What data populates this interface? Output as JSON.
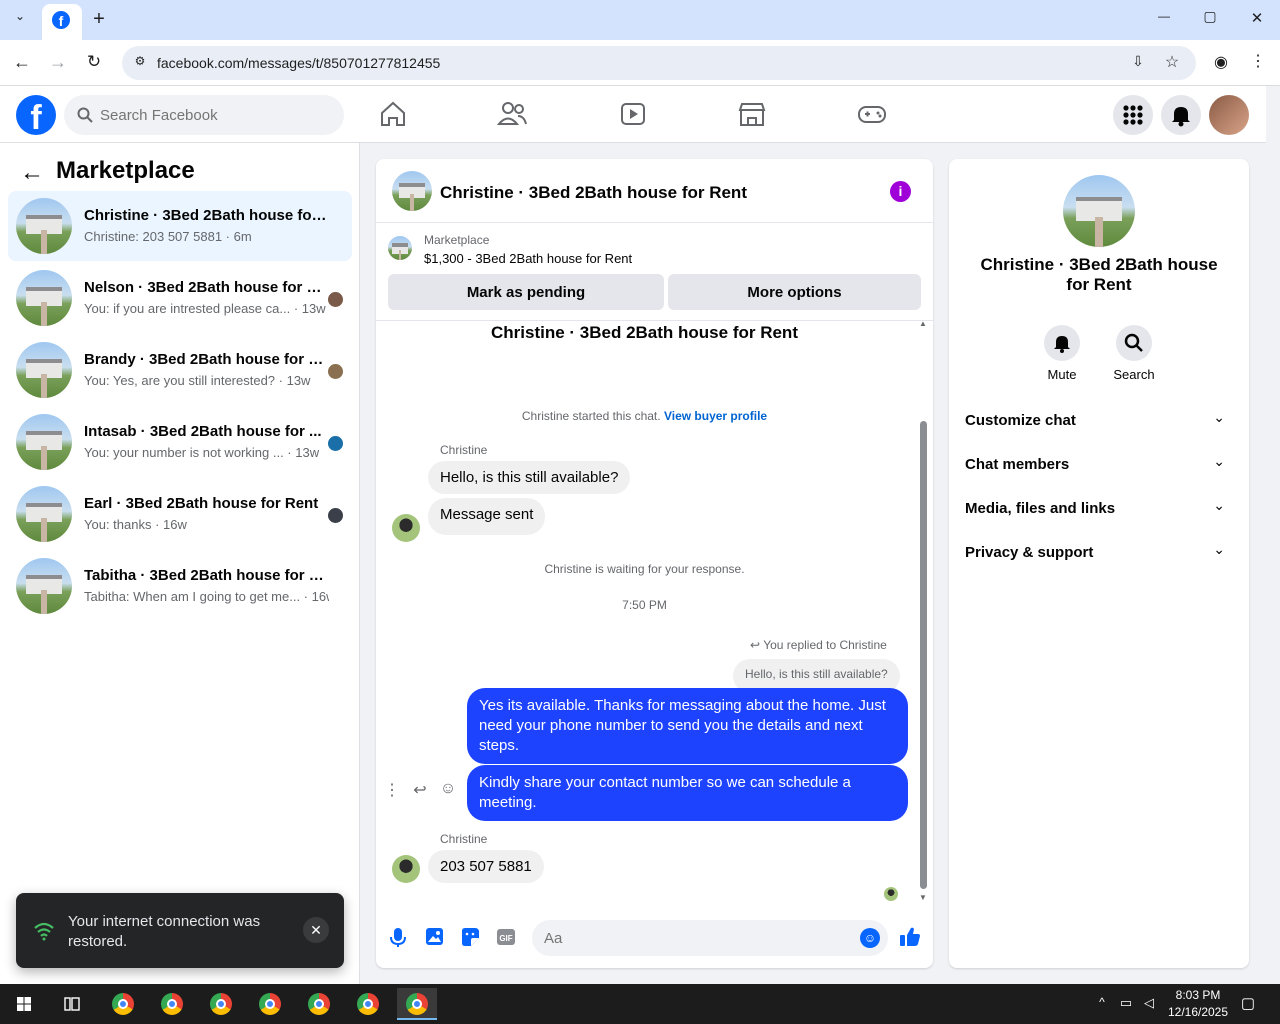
{
  "browser": {
    "url": "facebook.com/messages/t/850701277812455",
    "new_tab": "+",
    "window_controls": {
      "minimize": "—",
      "maximize": "▢",
      "close": "✕"
    }
  },
  "header": {
    "search_placeholder": "Search Facebook"
  },
  "left": {
    "title": "Marketplace",
    "conversations": [
      {
        "name": "Christine · 3Bed 2Bath house for R...",
        "snippet": "Christine: 203 507 5881 · 6m",
        "active": true
      },
      {
        "name": "Nelson · 3Bed 2Bath house for R...",
        "snippet": "You: if you are intrested please ca... · 13w"
      },
      {
        "name": "Brandy · 3Bed 2Bath house for R...",
        "snippet": "You: Yes, are you still interested? · 13w"
      },
      {
        "name": "Intasab · 3Bed 2Bath house for ...",
        "snippet": "You: your number is not working ... · 13w"
      },
      {
        "name": "Earl · 3Bed 2Bath house for Rent",
        "snippet": "You: thanks · 16w"
      },
      {
        "name": "Tabitha · 3Bed 2Bath house for Rent",
        "snippet": "Tabitha: When am I going to get me... · 16w"
      }
    ]
  },
  "chat": {
    "title": "Christine · 3Bed 2Bath house for Rent",
    "marketplace_label": "Marketplace",
    "listing": "$1,300 - 3Bed 2Bath house for Rent",
    "btn_pending": "Mark as pending",
    "btn_more": "More options",
    "thread_title": "Christine · 3Bed 2Bath house for Rent",
    "started": "Christine started this chat.",
    "view_profile": "View buyer profile",
    "sender1": "Christine",
    "msg1": "Hello, is this still available?",
    "msg2": "Message sent",
    "waiting": "Christine is waiting for your response.",
    "time": "7:50 PM",
    "replied_to": "You replied to Christine",
    "quoted": "Hello, is this still available?",
    "out1": "Yes its available. Thanks for messaging about the home. Just need your phone number to send you the details and next steps.",
    "out2": "Kindly share your contact number so we can schedule a meeting.",
    "sender2": "Christine",
    "msg3": "203 507 5881",
    "composer_placeholder": "Aa"
  },
  "right": {
    "name": "Christine · 3Bed 2Bath house for Rent",
    "mute": "Mute",
    "search": "Search",
    "rows": [
      "Customize chat",
      "Chat members",
      "Media, files and links",
      "Privacy & support"
    ]
  },
  "toast": {
    "text": "Your internet connection was restored."
  },
  "taskbar": {
    "time": "8:03 PM",
    "date": "12/16/2025"
  },
  "colors": {
    "accent": "#0866ff",
    "outgoing": "#1e43ff",
    "info": "#a000d8"
  }
}
